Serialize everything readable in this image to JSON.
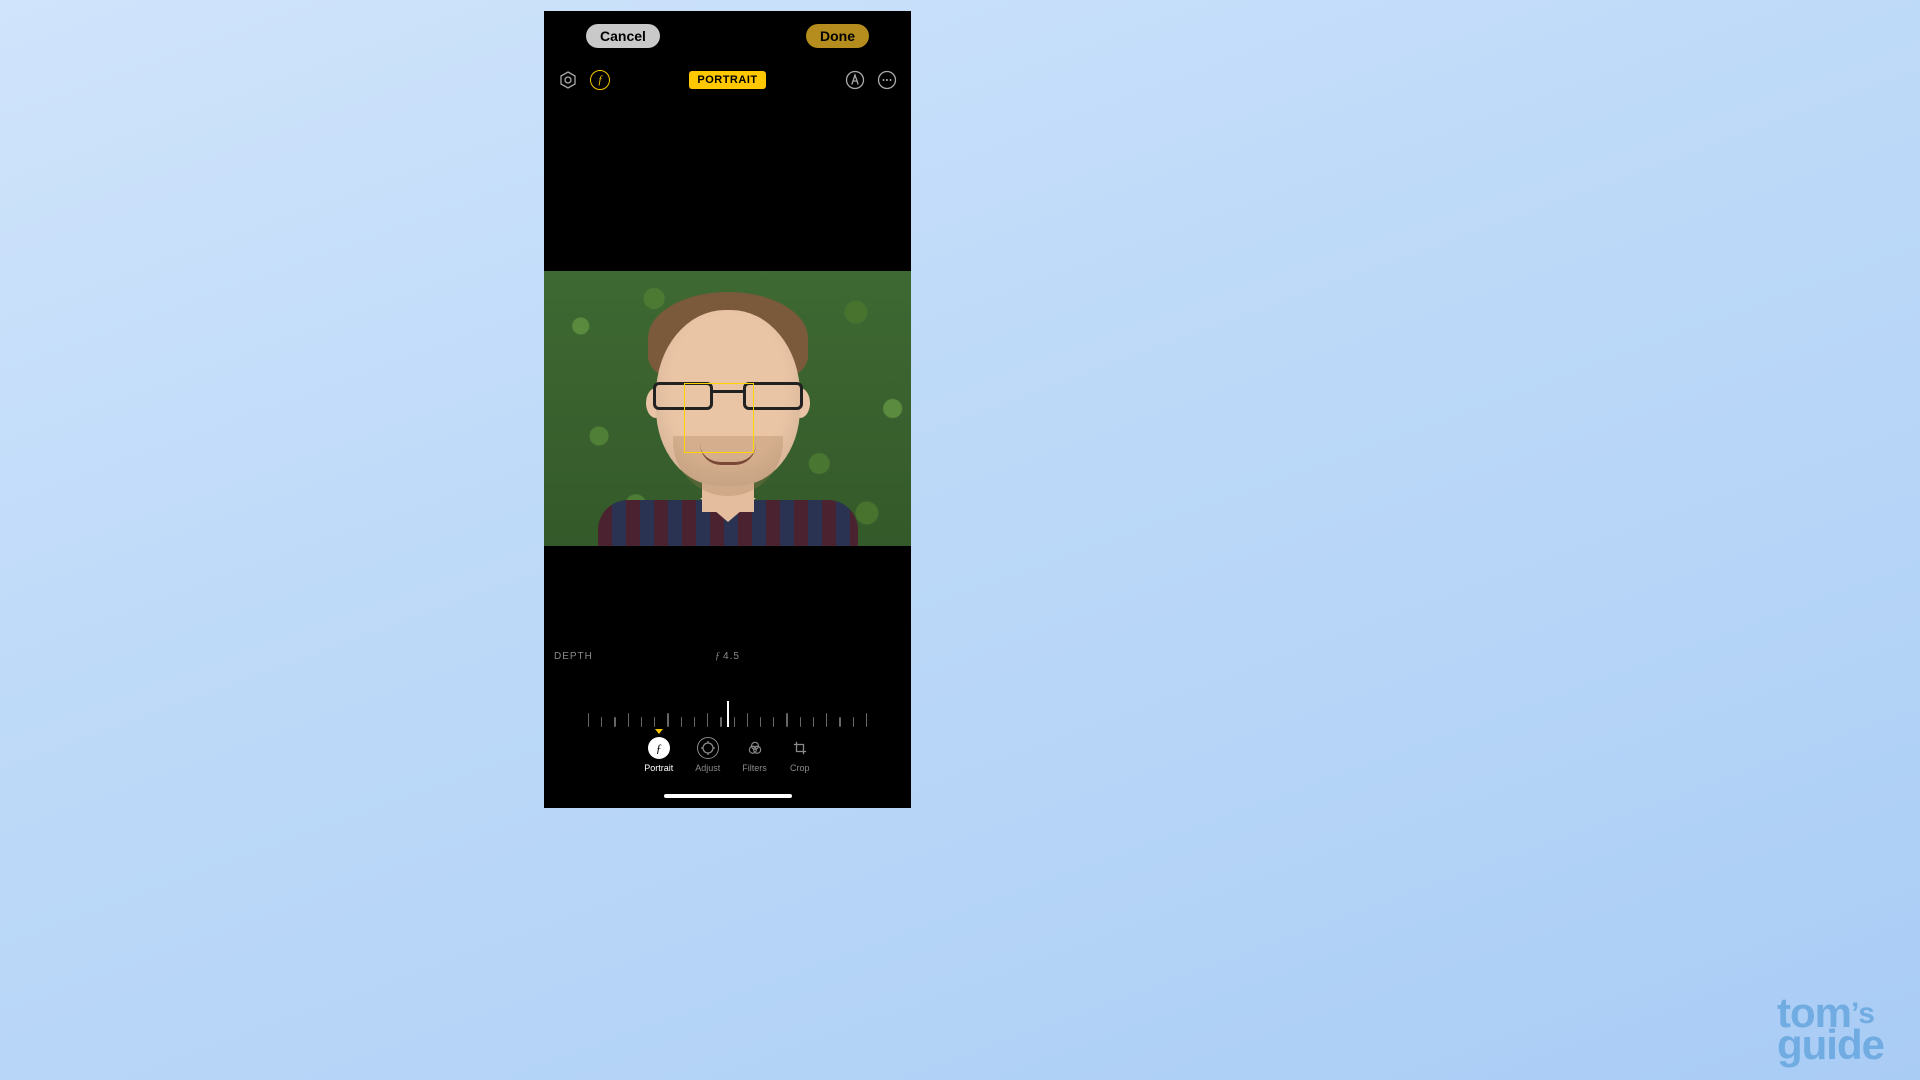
{
  "actions": {
    "cancel": "Cancel",
    "done": "Done"
  },
  "mode_badge": "PORTRAIT",
  "toolbar": {
    "lighting_icon": "portrait-lighting",
    "aperture_icon": "f",
    "markup_icon": "markup",
    "more_icon": "more"
  },
  "depth": {
    "label": "DEPTH",
    "f_symbol": "ƒ",
    "value": "4.5"
  },
  "tabs": [
    {
      "id": "portrait",
      "label": "Portrait",
      "active": true
    },
    {
      "id": "adjust",
      "label": "Adjust",
      "active": false
    },
    {
      "id": "filters",
      "label": "Filters",
      "active": false
    },
    {
      "id": "crop",
      "label": "Crop",
      "active": false
    }
  ],
  "watermark": {
    "line1": "tom",
    "apostrophe_s": "’s",
    "line2": "guide"
  }
}
